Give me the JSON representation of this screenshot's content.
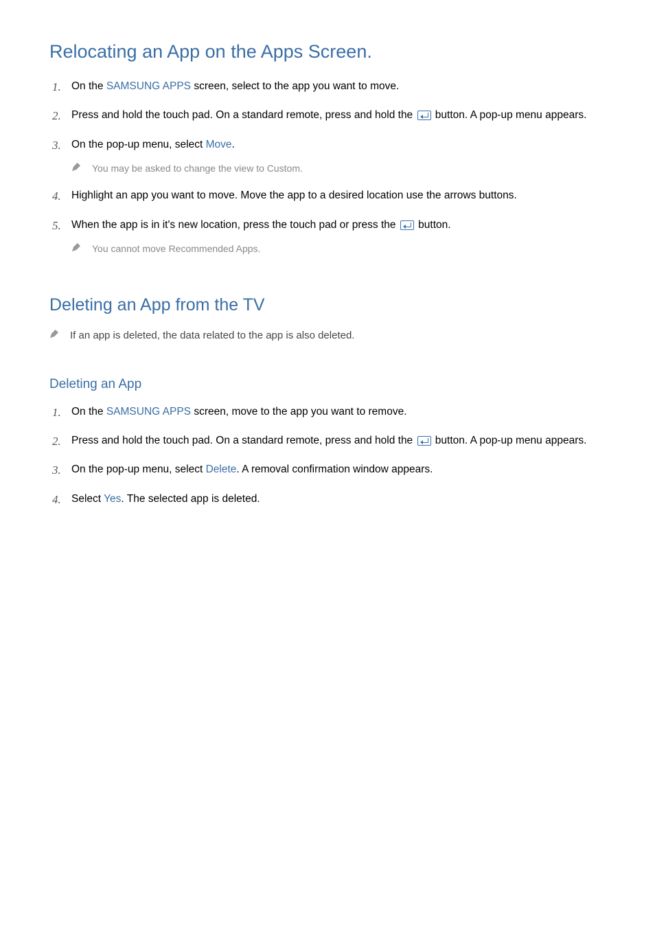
{
  "section1": {
    "title": "Relocating an App on the Apps Screen.",
    "step1_pre": "On the ",
    "step1_kw": "SAMSUNG APPS",
    "step1_post": " screen, select to the app you want to move.",
    "step2_pre": "Press and hold the touch pad. On a standard remote, press and hold the ",
    "step2_post": " button. A pop-up menu appears.",
    "step3_pre": "On the pop-up menu, select ",
    "step3_kw": "Move",
    "step3_post": ".",
    "note1": "You may be asked to change the view to Custom.",
    "step4": "Highlight an app you want to move. Move the app to a desired location use the arrows buttons.",
    "step5_pre": "When the app is in it's new location, press the touch pad or press the ",
    "step5_post": " button.",
    "note2": "You cannot move Recommended Apps."
  },
  "section2": {
    "title": "Deleting an App from the TV",
    "topnote": "If an app is deleted, the data related to the app is also deleted."
  },
  "section3": {
    "title": "Deleting an App",
    "step1_pre": "On the ",
    "step1_kw": "SAMSUNG APPS",
    "step1_post": " screen, move to the app you want to remove.",
    "step2_pre": "Press and hold the touch pad. On a standard remote, press and hold the ",
    "step2_post": " button. A pop-up menu appears.",
    "step3_pre": "On the pop-up menu, select ",
    "step3_kw": "Delete",
    "step3_post": ". A removal confirmation window appears.",
    "step4_pre": "Select ",
    "step4_kw": "Yes",
    "step4_post": ". The selected app is deleted."
  }
}
